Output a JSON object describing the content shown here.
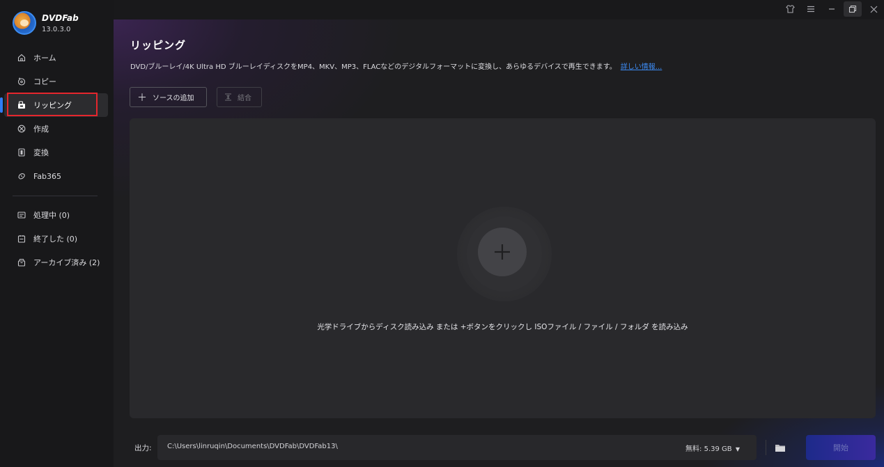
{
  "app": {
    "brand": "DVDFab",
    "version": "13.0.3.0"
  },
  "sidebar": {
    "items": [
      {
        "label": "ホーム",
        "icon": "home-icon"
      },
      {
        "label": "コピー",
        "icon": "copy-disc-icon"
      },
      {
        "label": "リッピング",
        "icon": "ripper-icon",
        "active": true
      },
      {
        "label": "作成",
        "icon": "creator-icon"
      },
      {
        "label": "変換",
        "icon": "converter-film-icon"
      },
      {
        "label": "Fab365",
        "icon": "fab365-icon"
      }
    ],
    "queue": [
      {
        "label": "処理中 (0)",
        "icon": "processing-icon"
      },
      {
        "label": "終了した (0)",
        "icon": "finished-icon"
      },
      {
        "label": "アーカイブ済み (2)",
        "icon": "archive-icon"
      }
    ]
  },
  "window": {
    "controls": [
      "shirt-skin-icon",
      "menu-icon",
      "minimize-icon",
      "restore-icon",
      "close-icon"
    ]
  },
  "main": {
    "title": "リッピング",
    "description": "DVD/ブルーレイ/4K Ultra HD ブルーレイディスクをMP4、MKV、MP3、FLACなどのデジタルフォーマットに変換し、あらゆるデバイスで再生できます。",
    "more_link": "詳しい情報...",
    "add_source_label": "ソースの追加",
    "merge_label": "結合",
    "drop_hint": "光学ドライブからディスク読み込み または +ボタンをクリックし ISOファイル / ファイル / フォルダ を読み込み"
  },
  "footer": {
    "output_label": "出力:",
    "output_path": "C:\\Users\\linruqin\\Documents\\DVDFab\\DVDFab13\\",
    "free_space": "無料:  5.39 GB",
    "start_label": "開始"
  },
  "colors": {
    "accent": "#2f7cf6",
    "highlight": "#e5262d",
    "link": "#3d8cf5"
  }
}
